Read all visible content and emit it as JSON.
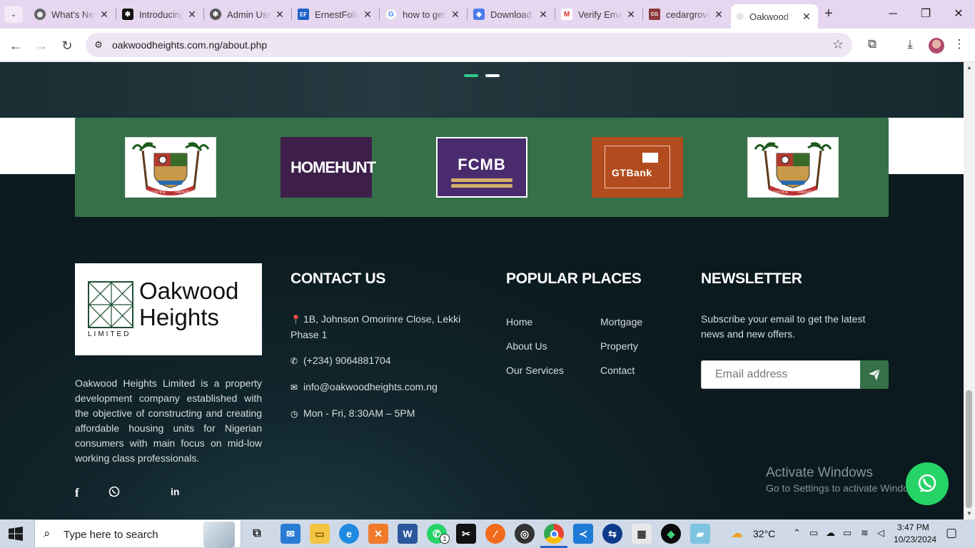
{
  "browser": {
    "tabs": [
      {
        "title": "What's New",
        "favicon": "chrome",
        "color": "#5f6368"
      },
      {
        "title": "Introducing",
        "favicon": "openai",
        "color": "#111111"
      },
      {
        "title": "Admin Users",
        "favicon": "openai",
        "color": "#444444"
      },
      {
        "title": "ErnestFolio",
        "favicon": "EF",
        "color": "#1e63c7"
      },
      {
        "title": "how to get",
        "favicon": "G",
        "color": "#4285f4"
      },
      {
        "title": "Download",
        "favicon": "drive",
        "color": "#4b7bec"
      },
      {
        "title": "Verify Email",
        "favicon": "M",
        "color": "#d93025"
      },
      {
        "title": "cedargrove",
        "favicon": "cedar",
        "color": "#8b3a3a"
      },
      {
        "title": "Oakwood",
        "favicon": "oak",
        "color": "#bbbbbb"
      }
    ],
    "url": "oakwoodheights.com.ng/about.php"
  },
  "partners": [
    {
      "name": "Lagos State",
      "motto": "JUSTICE AND PROGRESS"
    },
    {
      "name": "HOMEHUNT"
    },
    {
      "name": "FCMB"
    },
    {
      "name": "GTBank"
    },
    {
      "name": "Lagos State",
      "motto": "JUSTICE AND PROGRESS"
    }
  ],
  "footer": {
    "logo": {
      "line1": "Oakwood",
      "line2": "Heights",
      "sub": "LIMITED"
    },
    "about": "Oakwood Heights Limited is a property development company established with the objective of constructing and creating affordable housing units for Nigerian consumers with main focus on mid-low working class professionals.",
    "social": [
      "f",
      "whatsapp",
      "in"
    ],
    "contact": {
      "title": "CONTACT US",
      "address": "1B, Johnson Omorinre Close, Lekki Phase 1",
      "phone": "(+234) 9064881704",
      "email": "info@oakwoodheights.com.ng",
      "hours": "Mon - Fri, 8:30AM – 5PM"
    },
    "places": {
      "title": "POPULAR PLACES",
      "col1": [
        "Home",
        "About Us",
        "Our Services"
      ],
      "col2": [
        "Mortgage",
        "Property",
        "Contact"
      ]
    },
    "newsletter": {
      "title": "NEWSLETTER",
      "text": "Subscribe your email to get the latest news and new offers.",
      "placeholder": "Email address"
    }
  },
  "watermark": {
    "line1": "Activate Windows",
    "line2": "Go to Settings to activate Windows."
  },
  "taskbar": {
    "search_placeholder": "Type here to search",
    "temperature": "32°C",
    "time": "3:47 PM",
    "date": "10/23/2024",
    "whatsapp_badge": "1"
  },
  "colors": {
    "brand_green": "#367049",
    "footer_bg": "#0c1a1e",
    "whatsapp": "#25d366",
    "accent_dot": "#2ecc8a"
  }
}
